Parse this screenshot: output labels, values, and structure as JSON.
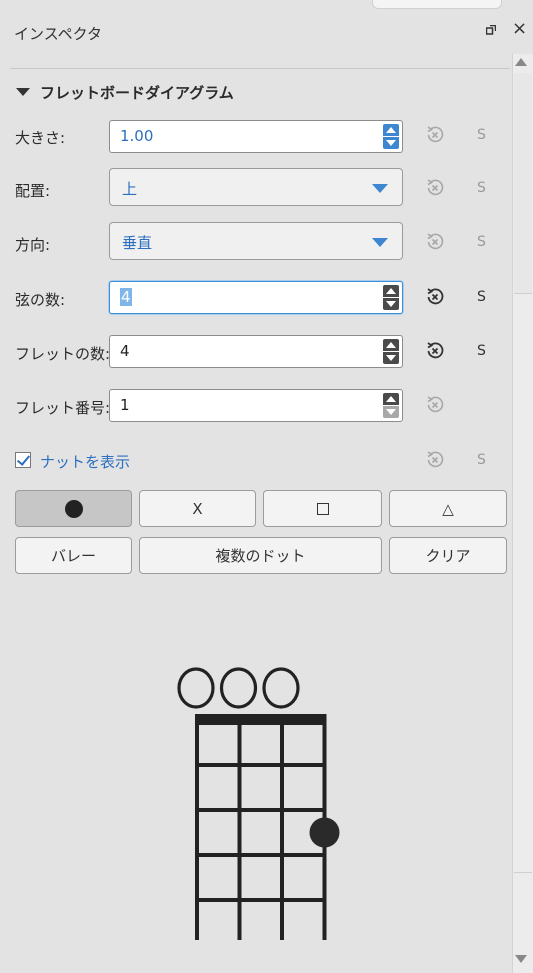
{
  "panel": {
    "title": "インスペクタ"
  },
  "section": {
    "title": "フレットボードダイアグラム"
  },
  "fields": {
    "size": {
      "label": "大きさ:",
      "value": "1.00"
    },
    "placement": {
      "label": "配置:",
      "value": "上"
    },
    "orientation": {
      "label": "方向:",
      "value": "垂直"
    },
    "strings": {
      "label": "弦の数:",
      "value": "4"
    },
    "frets": {
      "label": "フレットの数:",
      "value": "4"
    },
    "fret_number": {
      "label": "フレット番号:",
      "value": "1"
    }
  },
  "style_button_label": "S",
  "show_nut": {
    "label": "ナットを表示",
    "checked": true
  },
  "buttons": {
    "dot": {
      "icon": "filled-circle"
    },
    "x": {
      "label": "X"
    },
    "square": {
      "icon": "square"
    },
    "triangle": {
      "label": "△"
    },
    "barre": {
      "label": "バレー"
    },
    "multiple_dots": {
      "label": "複数のドット"
    },
    "clear": {
      "label": "クリア"
    }
  },
  "diagram": {
    "strings": 4,
    "frets": 4,
    "open_markers": [
      "O",
      "O",
      "O",
      ""
    ],
    "dots": [
      {
        "string": 4,
        "fret": 3
      }
    ]
  },
  "colors": {
    "accent": "#2c6fbf",
    "focus": "#3d8fd6",
    "background": "#e3e3e3"
  }
}
